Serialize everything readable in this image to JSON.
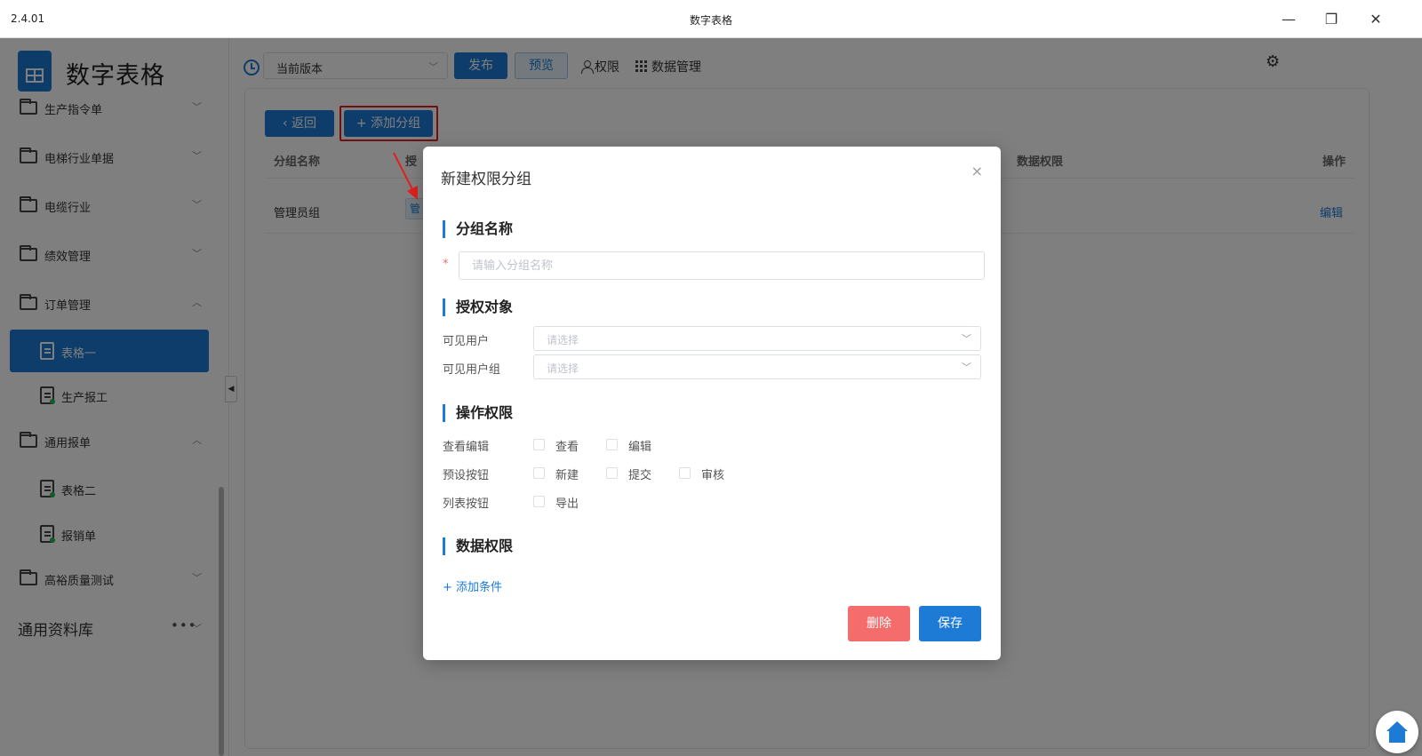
{
  "window": {
    "version": "2.4.01",
    "title": "数字表格",
    "controls": {
      "minimize": "—",
      "restore": "❐",
      "close": "✕"
    }
  },
  "sidebar": {
    "brand": "数字表格",
    "items": [
      {
        "label": "生产指令单",
        "expanded": false
      },
      {
        "label": "电梯行业单据",
        "expanded": false
      },
      {
        "label": "电缆行业",
        "expanded": false
      },
      {
        "label": "绩效管理",
        "expanded": false
      },
      {
        "label": "订单管理",
        "expanded": true
      }
    ],
    "order_children": [
      "表格一",
      "生产报工"
    ],
    "general": {
      "label": "通用报单",
      "children": [
        "表格二",
        "报销单"
      ]
    },
    "quality": "高裕质量测试",
    "library": {
      "label": "通用资料库",
      "more": "•••"
    },
    "collapse_glyph": "◀"
  },
  "toolbar": {
    "version_select": "当前版本",
    "publish": "发布",
    "preview": "预览",
    "permission": "权限",
    "data_mgmt": "数据管理",
    "settings_glyph": "⚙"
  },
  "panel": {
    "back": "返回",
    "add_group": "添加分组",
    "columns": [
      "分组名称",
      "授",
      "数据权限",
      "操作"
    ],
    "rows": [
      {
        "name": "管理员组",
        "tag": "管",
        "action": "编辑"
      }
    ]
  },
  "modal": {
    "title": "新建权限分组",
    "close_glyph": "×",
    "section_name": "分组名称",
    "name_placeholder": "请输入分组名称",
    "required_mark": "*",
    "section_target": "授权对象",
    "visible_users": "可见用户",
    "visible_groups": "可见用户组",
    "select_placeholder": "请选择",
    "section_ops": "操作权限",
    "view_edit": "查看编辑",
    "view": "查看",
    "edit": "编辑",
    "preset_buttons": "预设按钮",
    "create": "新建",
    "submit": "提交",
    "review": "审核",
    "list_buttons": "列表按钮",
    "export": "导出",
    "section_data": "数据权限",
    "add_condition": "添加条件",
    "delete": "删除",
    "save": "保存"
  },
  "colors": {
    "primary": "#1d7bd6",
    "danger": "#f56c6c",
    "highlight": "#e02020"
  }
}
